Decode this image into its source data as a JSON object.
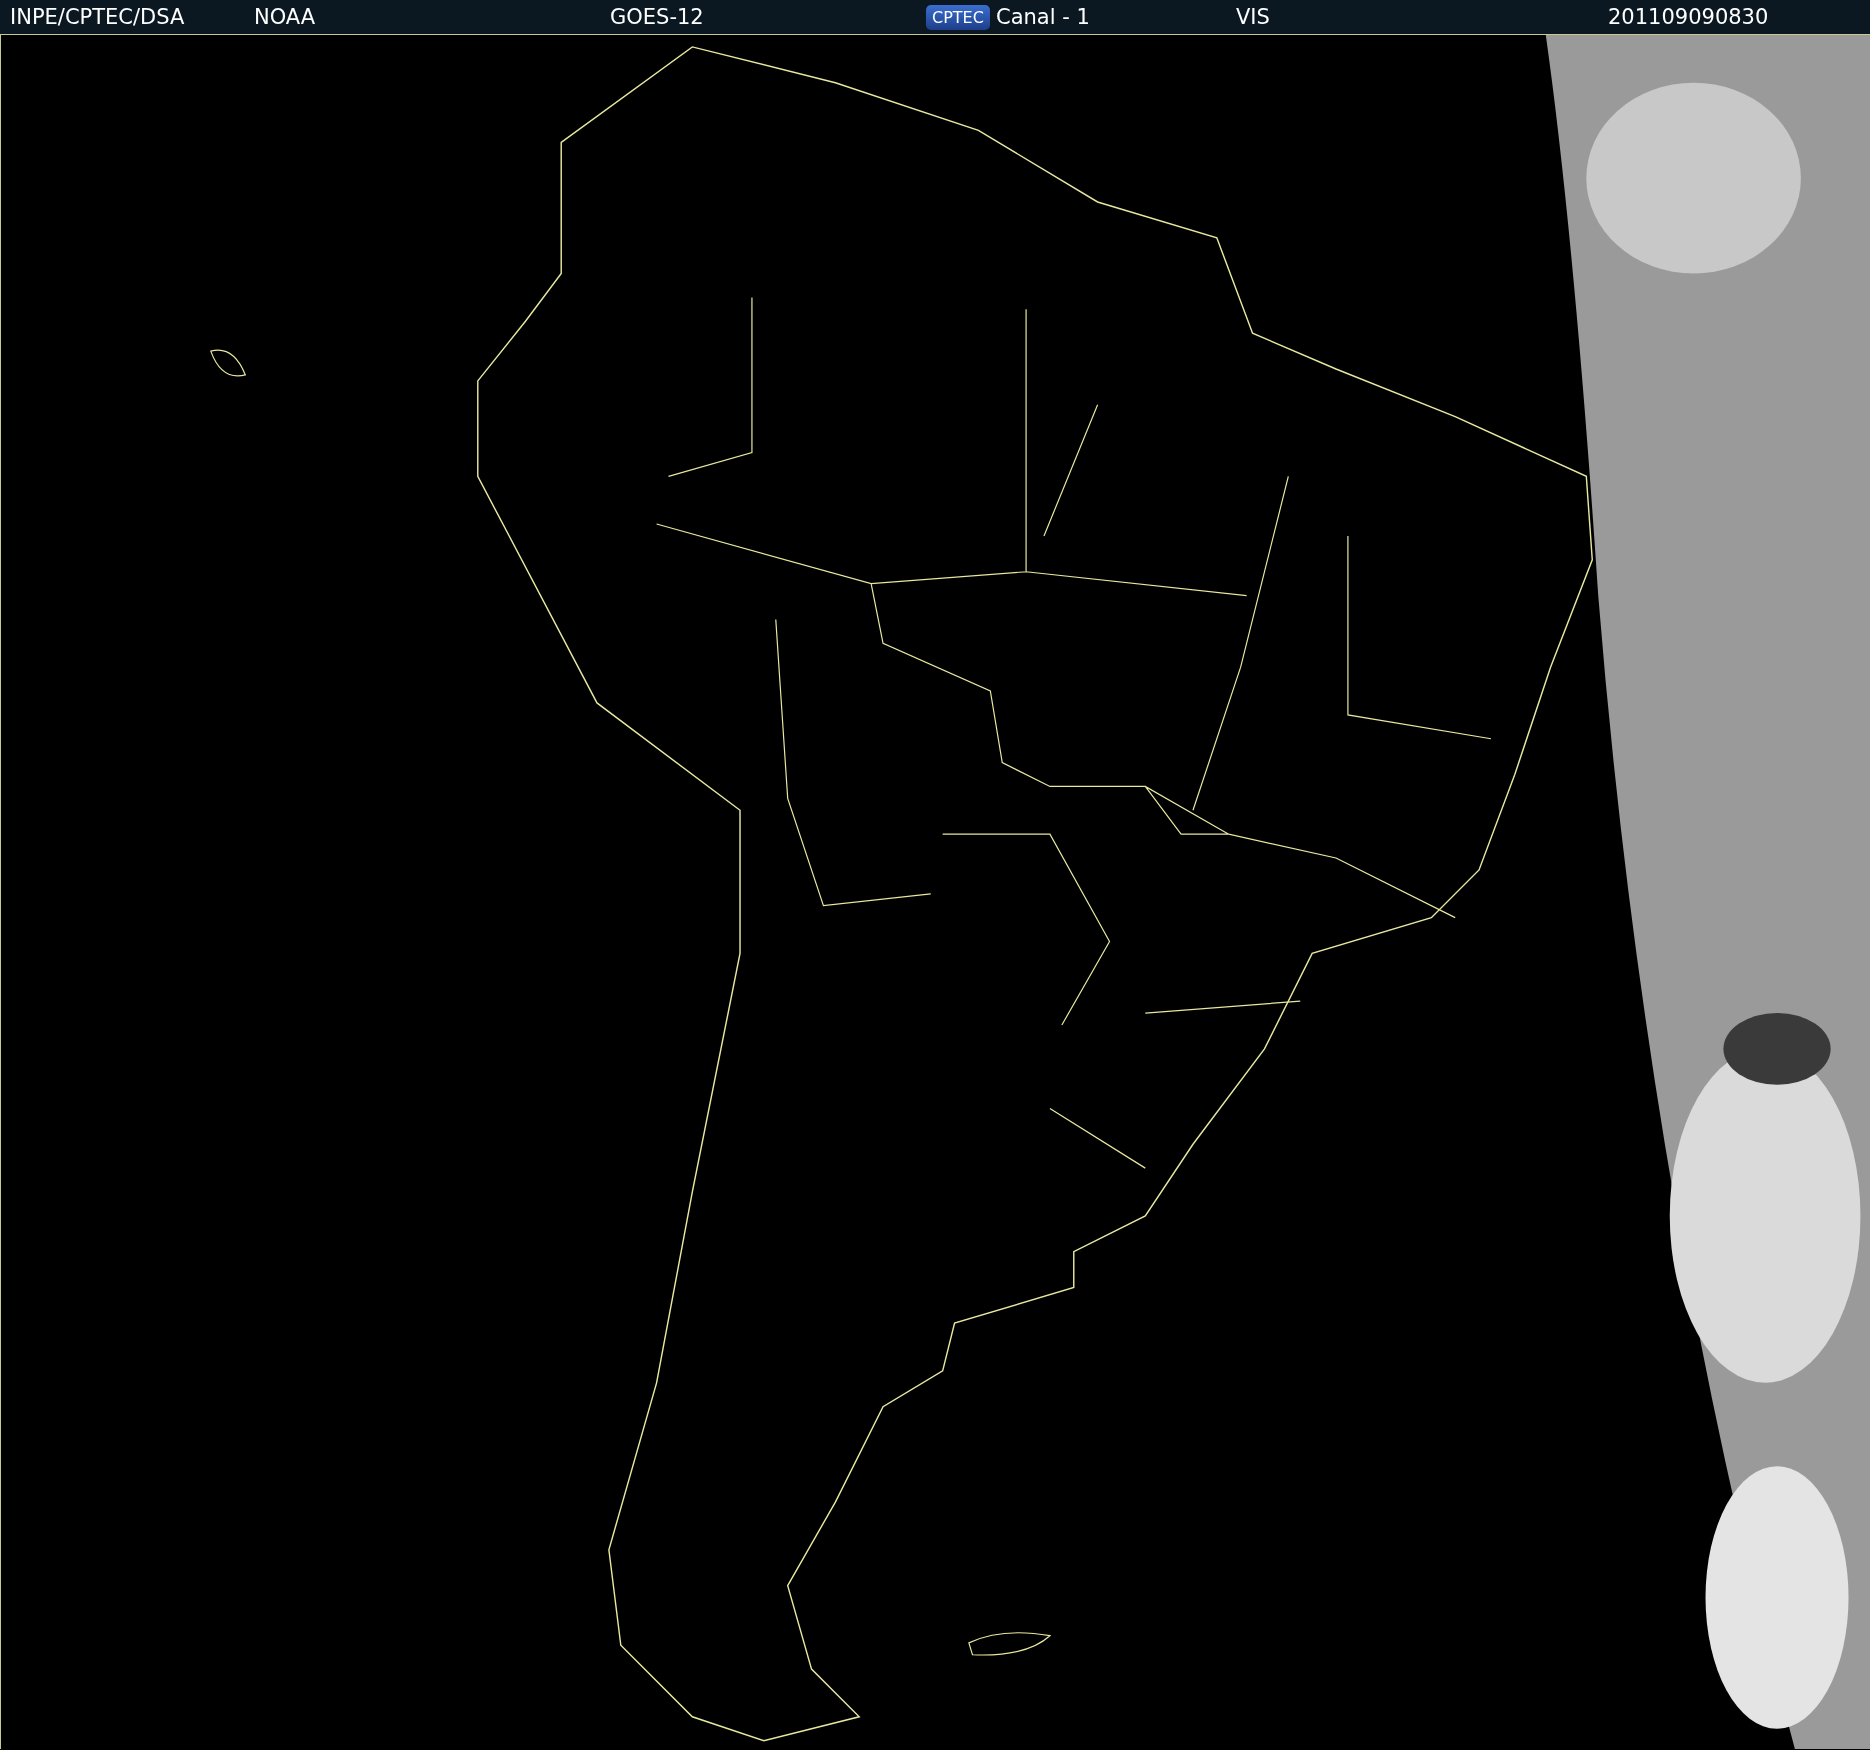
{
  "header": {
    "source": "INPE/CPTEC/DSA",
    "agency": "NOAA",
    "satellite": "GOES-12",
    "logo": "CPTEC",
    "channel": "Canal - 1",
    "band": "VIS",
    "timestamp": "201109090830"
  }
}
